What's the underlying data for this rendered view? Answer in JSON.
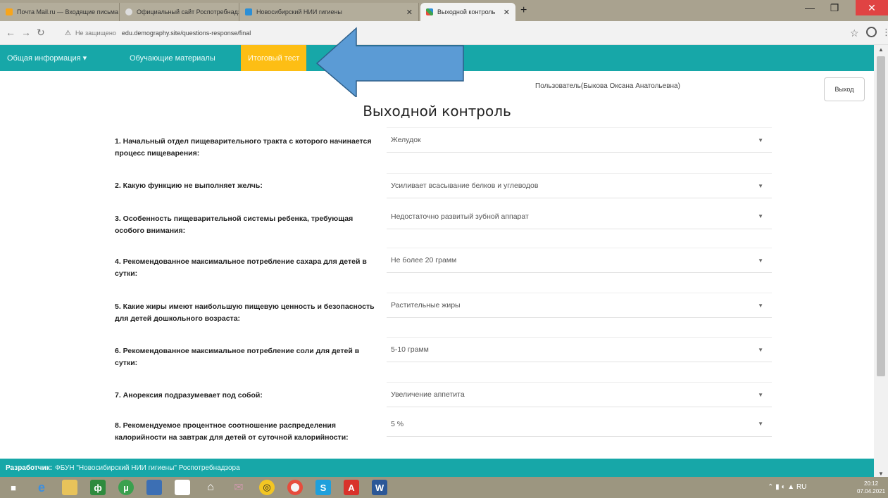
{
  "browser": {
    "tabs": [
      {
        "label": "Почта Mail.ru — Входящие письма"
      },
      {
        "label": "Официальный сайт Роспотребнадзора"
      },
      {
        "label": "Новосибирский НИИ гигиены"
      },
      {
        "label": "Выходной контроль"
      }
    ],
    "url_prefix": "Не защищено",
    "url": "edu.demography.site/questions-response/final",
    "new_tab_symbol": "+"
  },
  "sitenav": {
    "items": [
      {
        "label": "Общая информация ▾"
      },
      {
        "label": "Обучающие материалы"
      },
      {
        "label": "Итоговый тест"
      }
    ]
  },
  "user": {
    "line": "Пользователь(Быкова Оксана Анатольевна)",
    "logout_label": "Выход"
  },
  "page": {
    "title": "Выходной контроль"
  },
  "questions": [
    {
      "text": "1. Начальный отдел пищеварительного тракта с которого начинается процесс пищеварения:",
      "answer": "Желудок"
    },
    {
      "text": "2. Какую функцию не выполняет желчь:",
      "answer": "Усиливает всасывание белков и углеводов"
    },
    {
      "text": "3. Особенность пищеварительной системы ребенка, требующая особого внимания:",
      "answer": "Недостаточно развитый зубной аппарат"
    },
    {
      "text": "4. Рекомендованное максимальное потребление сахара для детей в сутки:",
      "answer": "Не более 20 грамм"
    },
    {
      "text": "5. Какие жиры имеют наибольшую пищевую ценность и безопасность для детей дошкольного возраста:",
      "answer": "Растительные жиры"
    },
    {
      "text": "6. Рекомендованное максимальное потребление соли для детей в сутки:",
      "answer": "5-10 грамм"
    },
    {
      "text": "7. Анорексия подразумевает под собой:",
      "answer": "Увеличение аппетита"
    },
    {
      "text": "8. Рекомендуемое процентное соотношение распределения калорийности на завтрак для детей от суточной калорийности:",
      "answer": "5 %"
    }
  ],
  "footer": {
    "label": "Разработчик:",
    "text": "ФБУН \"Новосибирский НИИ гигиены\" Роспотребнадзора"
  },
  "taskbar": {
    "tray_text": "RU",
    "time": "20:12",
    "date": "07.04.2021"
  },
  "colors": {
    "nav_teal": "#17a7a8",
    "active_tab_yellow": "#fdbe14",
    "arrow_blue": "#5b9bd5"
  }
}
